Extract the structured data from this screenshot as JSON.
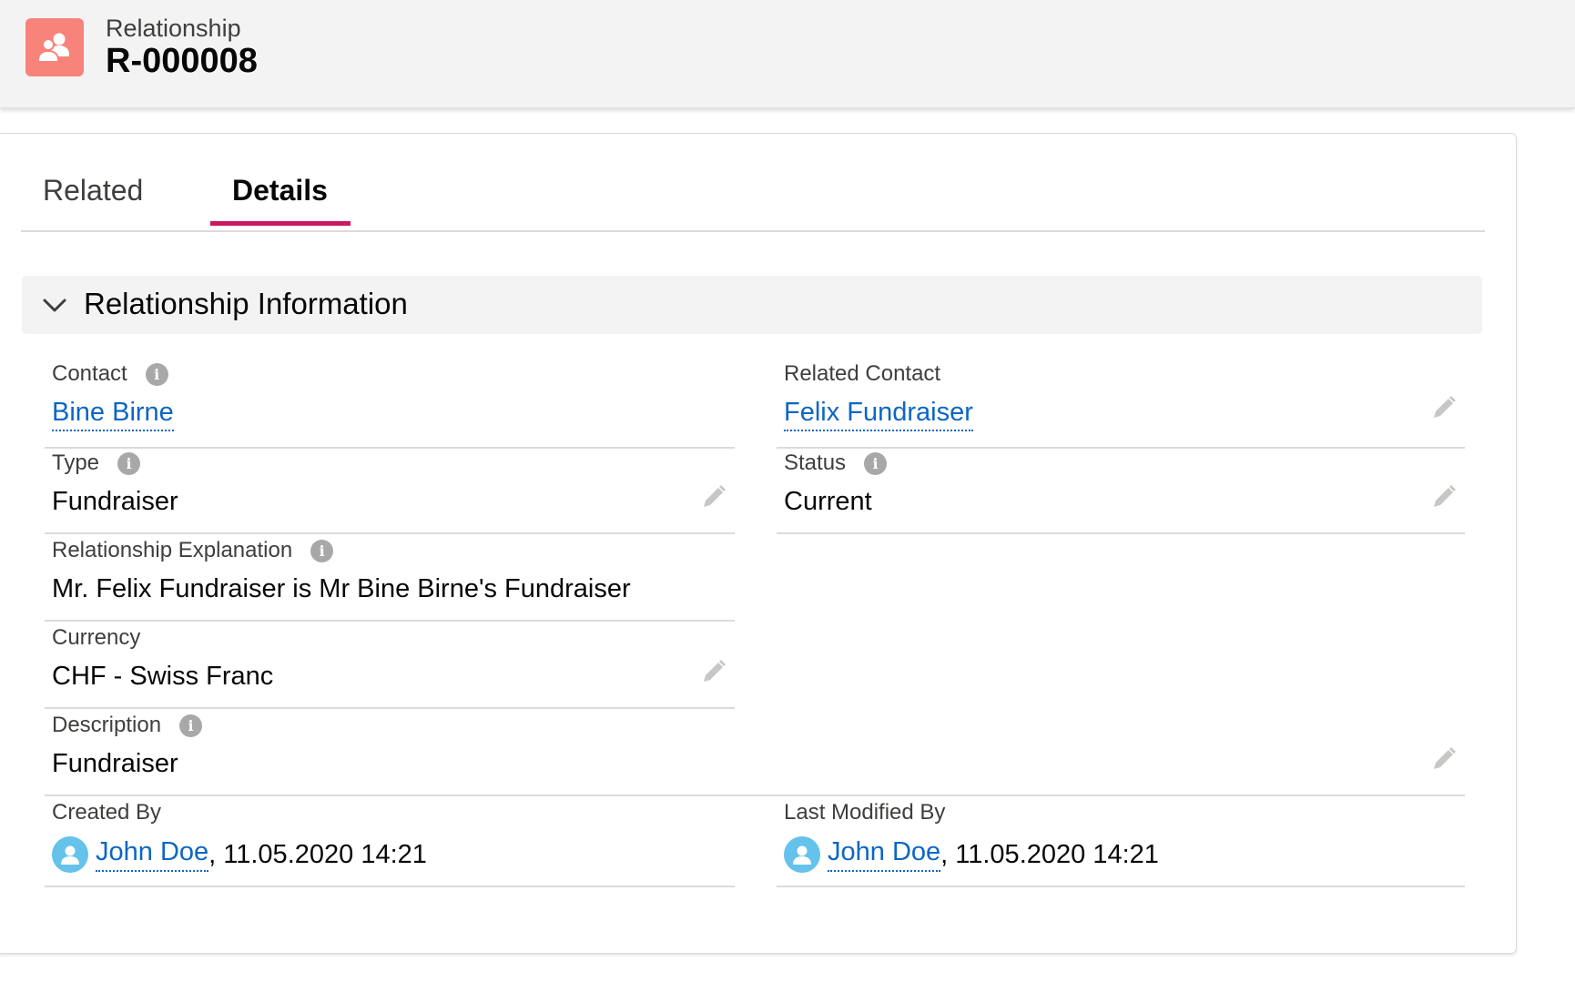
{
  "header": {
    "object_type": "Relationship",
    "record_name": "R-000008",
    "icon": "relationship-icon",
    "icon_color": "#f8837b"
  },
  "tabs": [
    {
      "label": "Related",
      "active": false
    },
    {
      "label": "Details",
      "active": true
    }
  ],
  "accent_color": "#c9185f",
  "link_color": "#0b66c4",
  "section": {
    "title": "Relationship Information",
    "expanded": true
  },
  "fields": {
    "contact": {
      "label": "Contact",
      "value": "Bine Birne"
    },
    "related_contact": {
      "label": "Related Contact",
      "value": "Felix Fundraiser"
    },
    "type": {
      "label": "Type",
      "value": "Fundraiser"
    },
    "status": {
      "label": "Status",
      "value": "Current"
    },
    "explanation": {
      "label": "Relationship Explanation",
      "value": "Mr. Felix Fundraiser is Mr Bine Birne's Fundraiser"
    },
    "currency": {
      "label": "Currency",
      "value": "CHF - Swiss Franc"
    },
    "description": {
      "label": "Description",
      "value": "Fundraiser"
    },
    "created_by": {
      "label": "Created By",
      "user": "John Doe",
      "timestamp": ", 11.05.2020 14:21"
    },
    "last_modified_by": {
      "label": "Last Modified By",
      "user": "John Doe",
      "timestamp": ", 11.05.2020 14:21"
    }
  }
}
